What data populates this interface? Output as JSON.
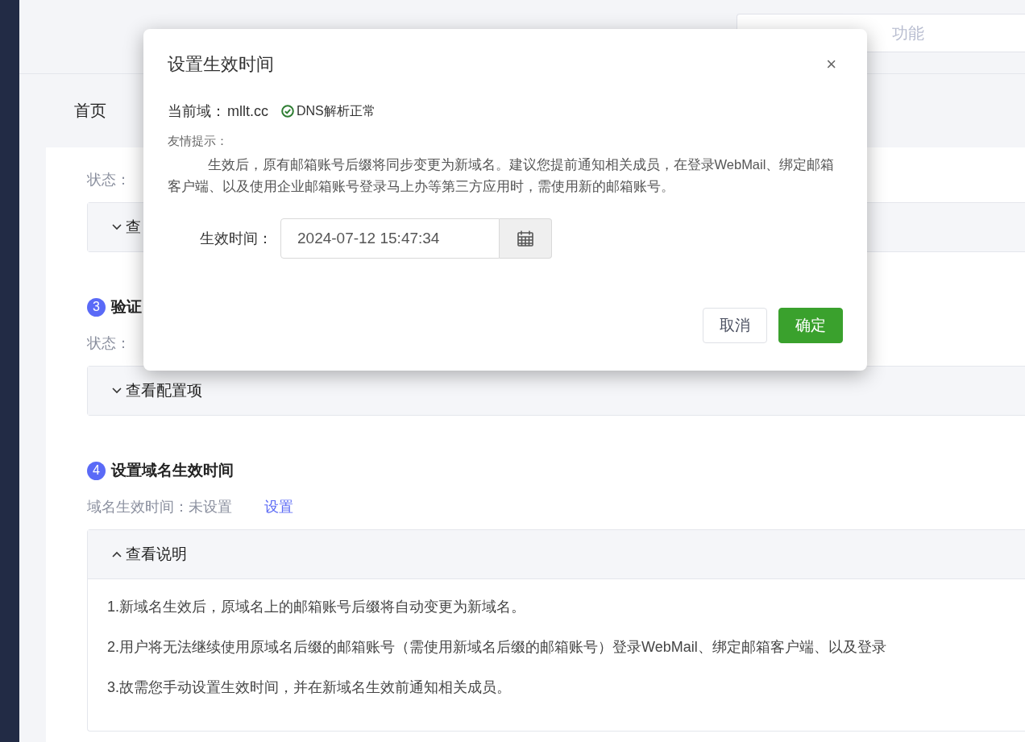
{
  "header": {
    "search": {
      "placeholder": "功能"
    }
  },
  "tabs": [
    {
      "label": "首页",
      "selected": true
    }
  ],
  "steps": [
    {
      "status_label": "状态：",
      "collapse": {
        "label": "查",
        "expanded": false
      }
    },
    {
      "number": "3",
      "title": "验证",
      "status_label": "状态：",
      "collapse": {
        "label": "查看配置项",
        "expanded": false
      }
    },
    {
      "number": "4",
      "title": "设置域名生效时间",
      "status_label": "域名生效时间：",
      "status_value": "未设置",
      "action_link": "设置",
      "collapse": {
        "label": "查看说明",
        "expanded": true,
        "items": [
          "1.新域名生效后，原域名上的邮箱账号后缀将自动变更为新域名。",
          "2.用户将无法继续使用原域名后缀的邮箱账号（需使用新域名后缀的邮箱账号）登录WebMail、绑定邮箱客户端、以及登录",
          "3.故需您手动设置生效时间，并在新域名生效前通知相关成员。"
        ]
      }
    }
  ],
  "dialog": {
    "title": "设置生效时间",
    "close": "×",
    "domain_label": "当前域：",
    "domain": "mllt.cc",
    "dns_status": "DNS解析正常",
    "tip_title": "友情提示：",
    "tip_text": "生效后，原有邮箱账号后缀将同步变更为新域名。建议您提前通知相关成员，在登录WebMail、绑定邮箱客户端、以及使用企业邮箱账号登录马上办等第三方应用时，需使用新的邮箱账号。",
    "field_label": "生效时间：",
    "field_value": "2024-07-12 15:47:34",
    "buttons": [
      {
        "label": "取消",
        "kind": "default"
      },
      {
        "label": "确定",
        "kind": "primary"
      }
    ]
  }
}
